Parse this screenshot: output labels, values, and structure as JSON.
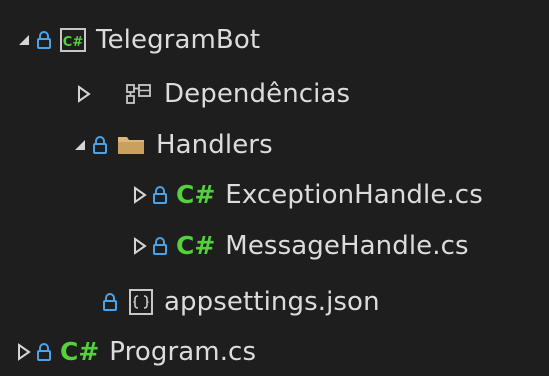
{
  "solution_explorer": {
    "items": [
      {
        "label": "TelegramBot",
        "type": "project",
        "expanded": true,
        "icon": "csharp-project-icon"
      },
      {
        "label": "Dependências",
        "type": "dependencies",
        "expanded": false,
        "icon": "dependencies-icon"
      },
      {
        "label": "Handlers",
        "type": "folder",
        "expanded": true,
        "icon": "folder-icon"
      },
      {
        "label": "ExceptionHandle.cs",
        "type": "cs-file",
        "expanded": false,
        "icon": "csharp-file-icon"
      },
      {
        "label": "MessageHandle.cs",
        "type": "cs-file",
        "expanded": false,
        "icon": "csharp-file-icon"
      },
      {
        "label": "appsettings.json",
        "type": "json-file",
        "icon": "json-file-icon"
      },
      {
        "label": "Program.cs",
        "type": "cs-file",
        "expanded": false,
        "icon": "csharp-file-icon"
      }
    ],
    "cs_glyph": "C#"
  },
  "colors": {
    "background": "#1e1e1e",
    "text": "#dcdcdc",
    "lock": "#4aa3e8",
    "csharp": "#54d13c",
    "folder": "#dcb67a",
    "arrow": "#d4d4d4"
  }
}
